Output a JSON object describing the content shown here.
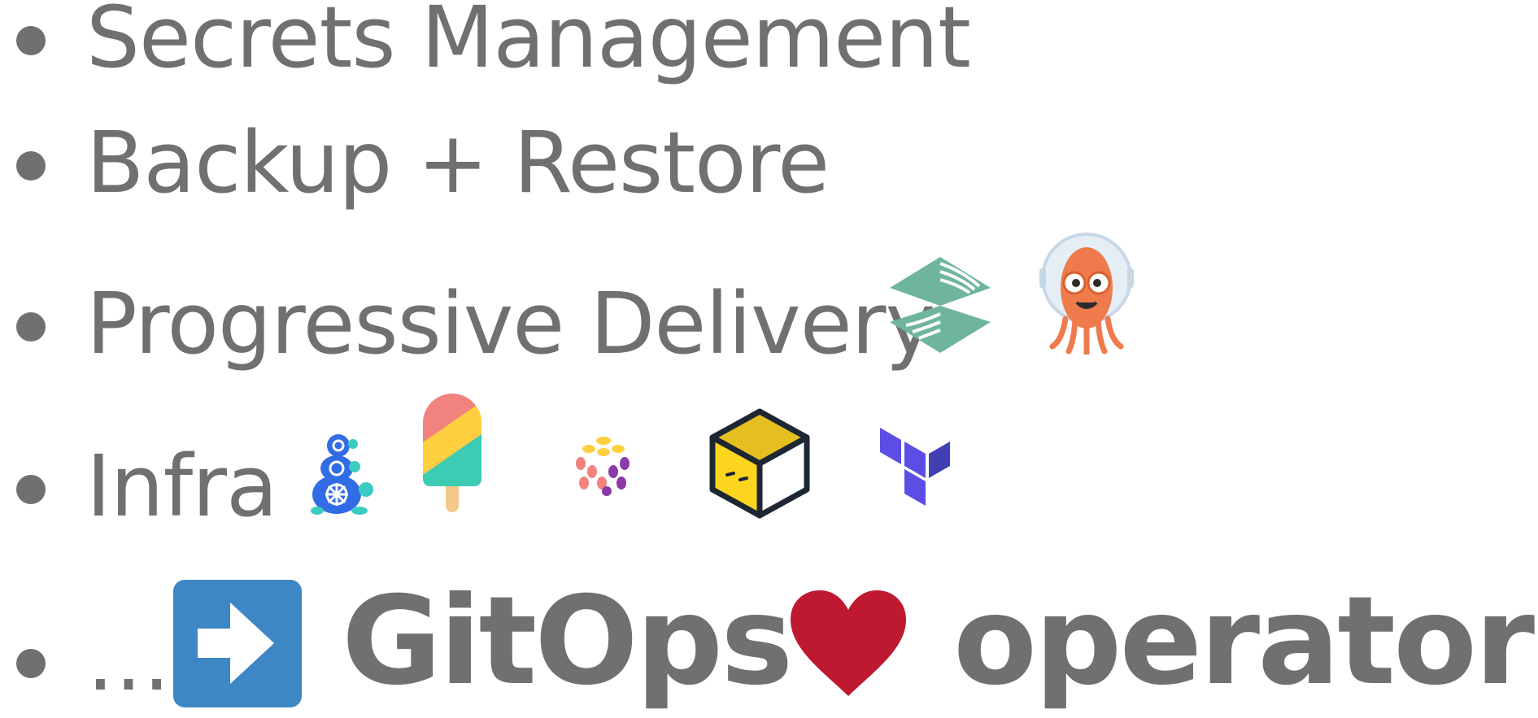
{
  "bullets": [
    {
      "label": "Secrets Management"
    },
    {
      "label": "Backup + Restore"
    },
    {
      "label": "Progressive Delivery"
    },
    {
      "label": "Infra"
    },
    {
      "label": "…"
    }
  ],
  "tagline": {
    "left": "GitOps",
    "right": "operators"
  },
  "colors": {
    "text": "#707070",
    "arrow_box": "#3d87c5",
    "heart": "#be1931",
    "terraform": "#5c4ee5",
    "flagger": "#6fb59e",
    "argo": "#ef7b4d"
  },
  "icons": [
    "flagger-logo",
    "argo-logo",
    "cluster-api-turtles-logo",
    "popsicle-logo",
    "crossplane-dots-logo",
    "box-logo",
    "terraform-logo",
    "arrow-right-icon",
    "heart-icon"
  ]
}
